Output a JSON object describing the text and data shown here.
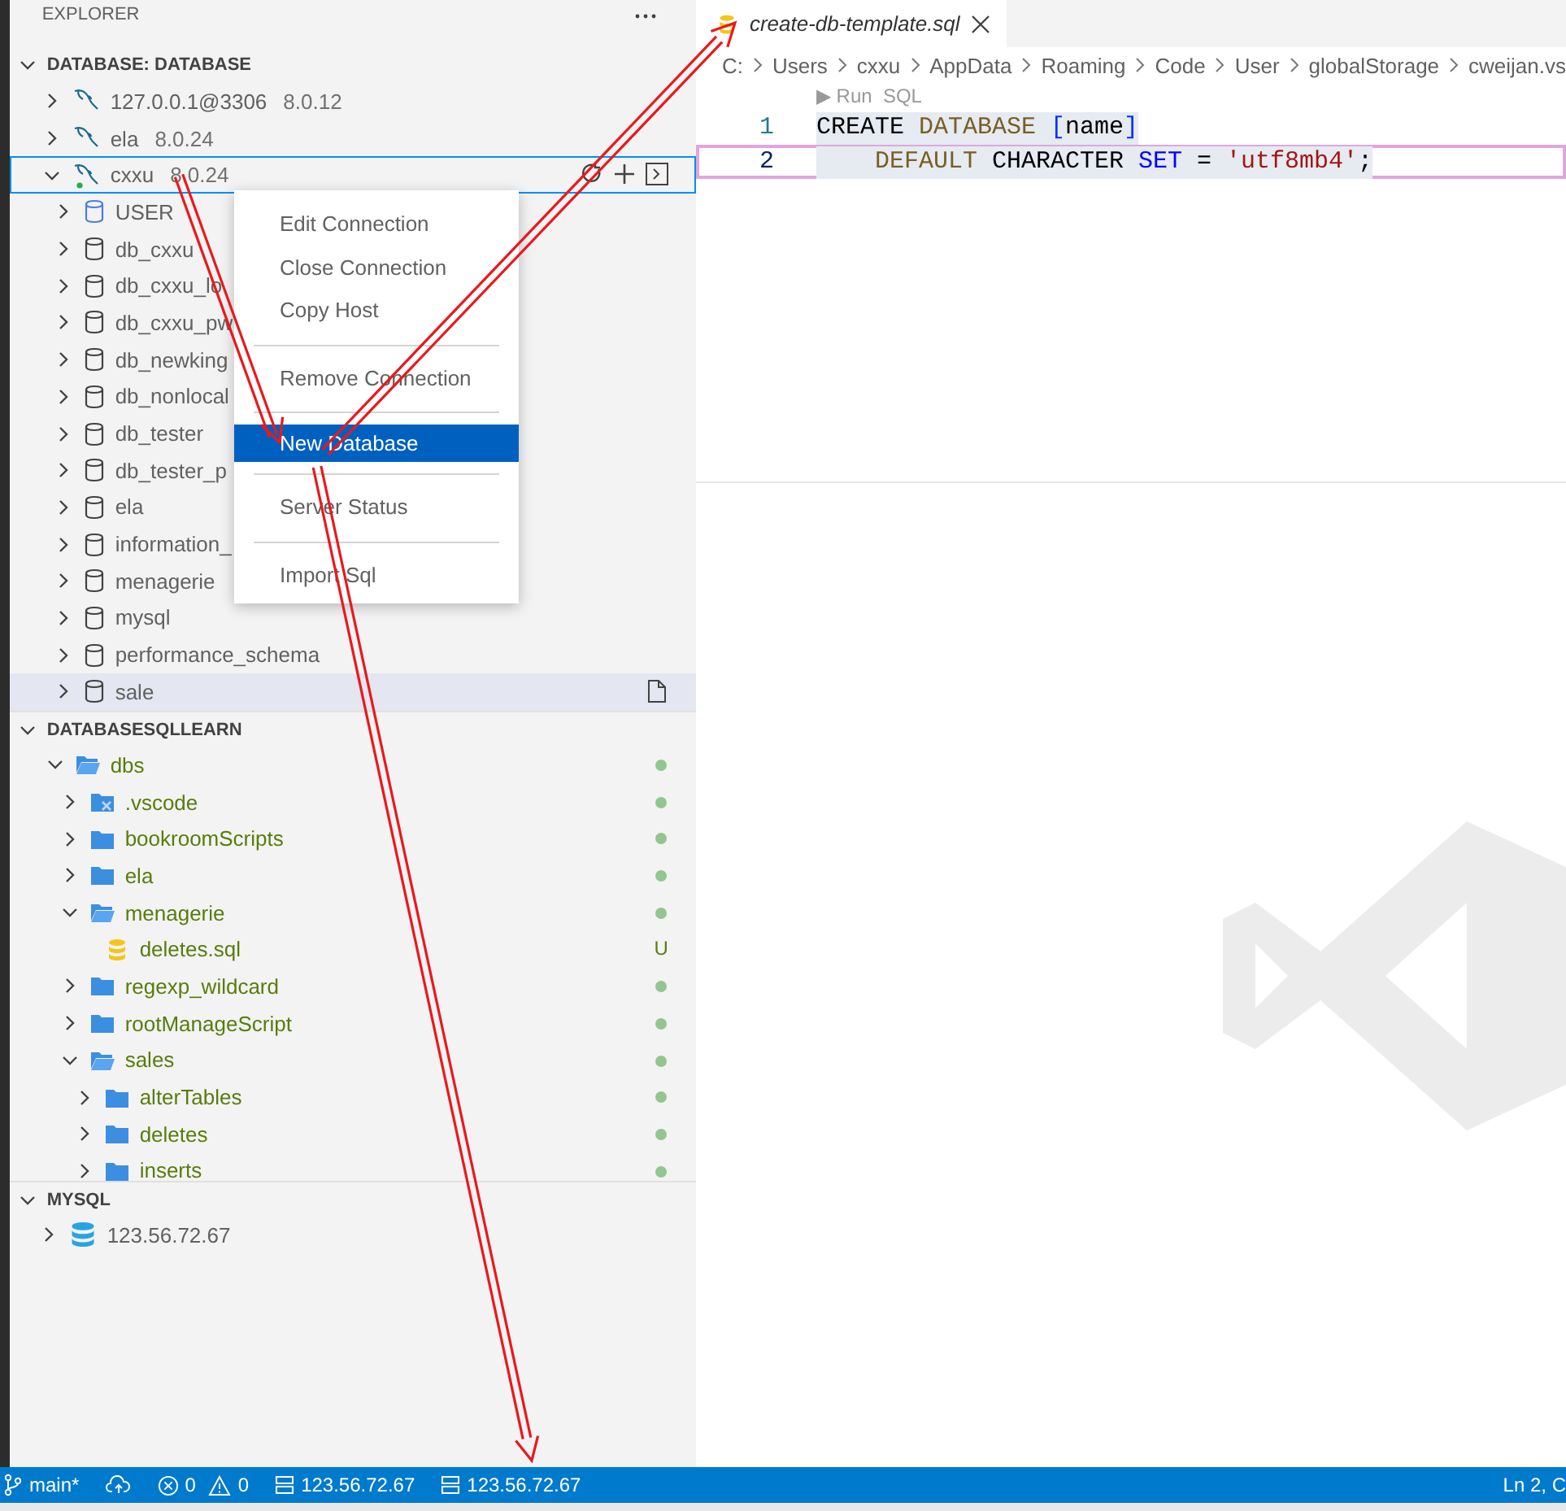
{
  "sidebar": {
    "title": "EXPLORER",
    "database_section": {
      "title": "DATABASE: DATABASE",
      "expanded": true,
      "connections": [
        {
          "name": "127.0.0.1@3306",
          "version": "8.0.12",
          "expanded": false,
          "connected": false,
          "selected": false
        },
        {
          "name": "ela",
          "version": "8.0.24",
          "expanded": false,
          "connected": false,
          "selected": false
        },
        {
          "name": "cxxu",
          "version": "8.0.24",
          "expanded": true,
          "connected": true,
          "selected": true,
          "databases": [
            {
              "name": "USER",
              "kind": "user",
              "hovered": false
            },
            {
              "name": "db_cxxu",
              "kind": "database",
              "hovered": false
            },
            {
              "name": "db_cxxu_lo",
              "kind": "database",
              "hovered": false
            },
            {
              "name": "db_cxxu_pw",
              "kind": "database",
              "hovered": false
            },
            {
              "name": "db_newking",
              "kind": "database",
              "hovered": false
            },
            {
              "name": "db_nonlocal",
              "kind": "database",
              "hovered": false
            },
            {
              "name": "db_tester",
              "kind": "database",
              "hovered": false
            },
            {
              "name": "db_tester_p",
              "kind": "database",
              "hovered": false
            },
            {
              "name": "ela",
              "kind": "database",
              "hovered": false
            },
            {
              "name": "information_",
              "kind": "database",
              "hovered": false
            },
            {
              "name": "menagerie",
              "kind": "database",
              "hovered": false
            },
            {
              "name": "mysql",
              "kind": "database",
              "hovered": false
            },
            {
              "name": "performance_schema",
              "kind": "database",
              "hovered": false
            },
            {
              "name": "sale",
              "kind": "database",
              "hovered": true
            }
          ]
        }
      ]
    },
    "workspace_section": {
      "title": "DATABASESQLLEARN",
      "expanded": true,
      "tree": [
        {
          "name": "dbs",
          "kind": "folder",
          "expanded": true,
          "changes_dot": true,
          "children": [
            {
              "name": ".vscode",
              "kind": "vscode-folder",
              "expanded": false,
              "changes_dot": true
            },
            {
              "name": "bookroomScripts",
              "kind": "folder",
              "expanded": false,
              "changes_dot": true
            },
            {
              "name": "ela",
              "kind": "folder",
              "expanded": false,
              "changes_dot": true
            },
            {
              "name": "menagerie",
              "kind": "folder",
              "expanded": true,
              "changes_dot": true,
              "children": [
                {
                  "name": "deletes.sql",
                  "kind": "sql-file",
                  "changes_dot": false,
                  "badge": "U"
                }
              ]
            },
            {
              "name": "regexp_wildcard",
              "kind": "folder",
              "expanded": false,
              "changes_dot": true
            },
            {
              "name": "rootManageScript",
              "kind": "folder",
              "expanded": false,
              "changes_dot": true
            },
            {
              "name": "sales",
              "kind": "folder",
              "expanded": true,
              "changes_dot": true,
              "children": [
                {
                  "name": "alterTables",
                  "kind": "folder",
                  "expanded": false,
                  "changes_dot": true
                },
                {
                  "name": "deletes",
                  "kind": "folder",
                  "expanded": false,
                  "changes_dot": true
                },
                {
                  "name": "inserts",
                  "kind": "folder",
                  "expanded": false,
                  "changes_dot": true
                }
              ]
            }
          ]
        }
      ]
    },
    "mysql_section": {
      "title": "MYSQL",
      "expanded": true,
      "items": [
        {
          "name": "123.56.72.67",
          "expanded": false
        }
      ]
    }
  },
  "context_menu": {
    "groups": [
      [
        {
          "label": "Edit Connection",
          "selected": false
        },
        {
          "label": "Close Connection",
          "selected": false
        },
        {
          "label": "Copy Host",
          "selected": false
        }
      ],
      [
        {
          "label": "Remove Connection",
          "selected": false
        }
      ],
      [
        {
          "label": "New Database",
          "selected": true
        }
      ],
      [
        {
          "label": "Server Status",
          "selected": false
        }
      ],
      [
        {
          "label": "Import Sql",
          "selected": false
        }
      ]
    ]
  },
  "editor": {
    "tabs": [
      {
        "title": "create-db-template.sql",
        "selected": true
      }
    ],
    "breadcrumb": [
      "C:",
      "Users",
      "cxxu",
      "AppData",
      "Roaming",
      "Code",
      "User",
      "globalStorage",
      "cweijan.vs"
    ],
    "codelens": "▶ Run  SQL",
    "lines": [
      {
        "number": "1",
        "current": false,
        "selected": true,
        "tokens": [
          {
            "text": "CREATE ",
            "kind": "plain"
          },
          {
            "text": "DATABASE ",
            "kind": "function"
          },
          {
            "text": "[",
            "kind": "bracket"
          },
          {
            "text": "name",
            "kind": "plain"
          },
          {
            "text": "]",
            "kind": "bracket"
          }
        ]
      },
      {
        "number": "2",
        "current": true,
        "selected": true,
        "tokens": [
          {
            "text": "    DEFAULT ",
            "kind": "function"
          },
          {
            "text": "CHARACTER ",
            "kind": "plain"
          },
          {
            "text": "SET",
            "kind": "keyword"
          },
          {
            "text": " = ",
            "kind": "plain"
          },
          {
            "text": "'utf8mb4'",
            "kind": "string"
          },
          {
            "text": ";",
            "kind": "plain"
          }
        ]
      }
    ]
  },
  "status_bar": {
    "branch": "main*",
    "errors": "0",
    "warnings": "0",
    "connections": [
      "123.56.72.67",
      "123.56.72.67"
    ],
    "position": "Ln 2, C"
  }
}
